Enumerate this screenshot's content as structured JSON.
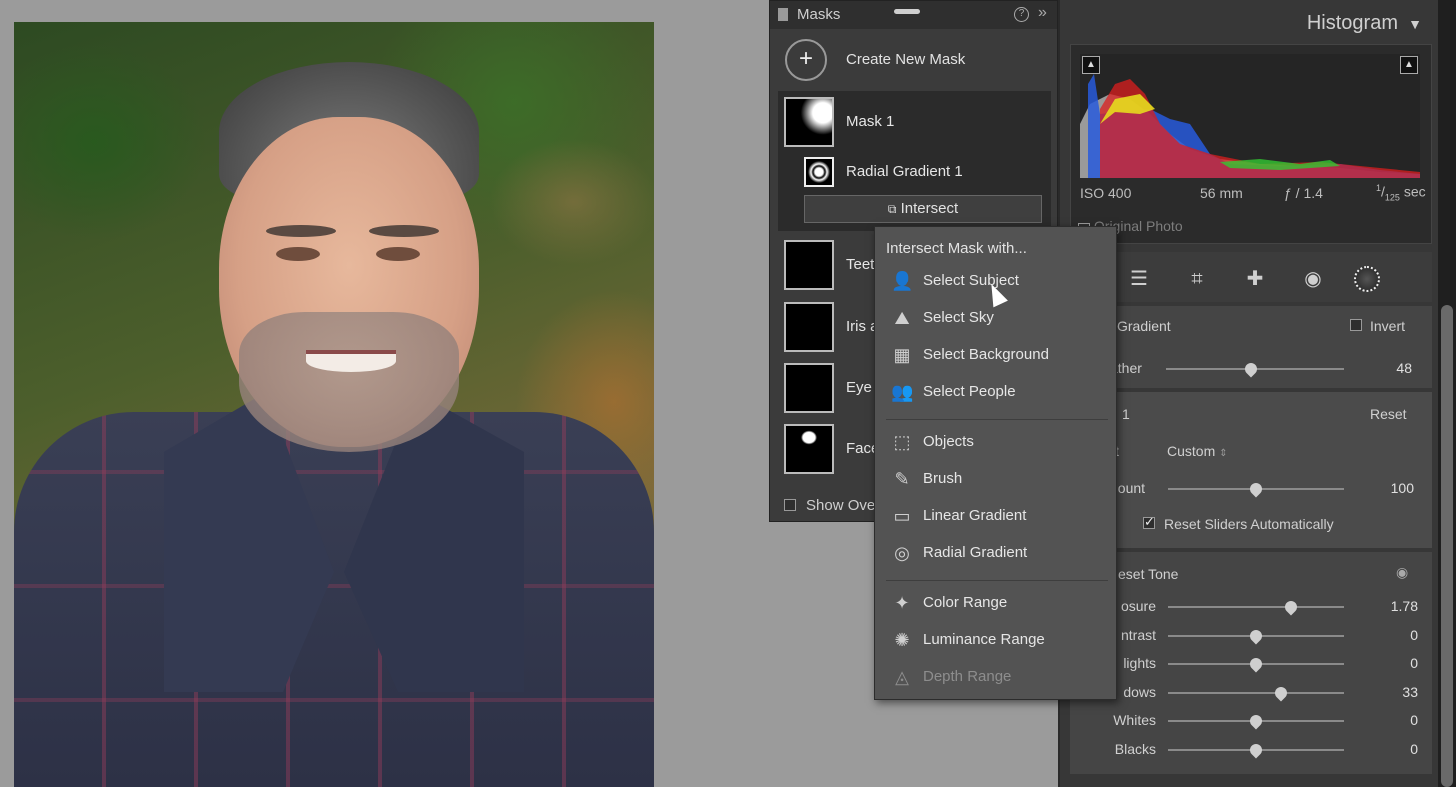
{
  "masks_panel": {
    "title": "Masks",
    "create_label": "Create New Mask",
    "mask1": {
      "name": "Mask 1",
      "component": "Radial Gradient 1",
      "intersect_label": "Intersect"
    },
    "other_masks": [
      "Teet",
      "Iris a",
      "Eye",
      "Face"
    ],
    "show_overlay_label": "Show Ove"
  },
  "menu": {
    "heading": "Intersect Mask with...",
    "groups": [
      [
        {
          "label": "Select Subject",
          "icon": "subject-icon",
          "enabled": true
        },
        {
          "label": "Select Sky",
          "icon": "sky-icon",
          "enabled": true
        },
        {
          "label": "Select Background",
          "icon": "background-icon",
          "enabled": true
        },
        {
          "label": "Select People",
          "icon": "people-icon",
          "enabled": true
        }
      ],
      [
        {
          "label": "Objects",
          "icon": "objects-icon",
          "enabled": true
        },
        {
          "label": "Brush",
          "icon": "brush-icon",
          "enabled": true
        },
        {
          "label": "Linear Gradient",
          "icon": "linear-gradient-icon",
          "enabled": true
        },
        {
          "label": "Radial Gradient",
          "icon": "radial-gradient-icon",
          "enabled": true
        }
      ],
      [
        {
          "label": "Color Range",
          "icon": "color-range-icon",
          "enabled": true
        },
        {
          "label": "Luminance Range",
          "icon": "luminance-range-icon",
          "enabled": true
        },
        {
          "label": "Depth Range",
          "icon": "depth-range-icon",
          "enabled": false
        }
      ]
    ]
  },
  "histogram": {
    "title": "Histogram",
    "iso": "ISO 400",
    "focal": "56 mm",
    "aperture": "ƒ / 1.4",
    "shutter": "1/125 sec",
    "shutter_num": "1",
    "shutter_den": "125",
    "shutter_unit": "sec",
    "original_photo_label": "Original Photo"
  },
  "mask_props": {
    "type_label": "l Gradient",
    "invert_label": "Invert",
    "feather_label": "ather",
    "feather_value": "48",
    "feather_pct": 0.48
  },
  "preset": {
    "title": "1",
    "reset_label": "Reset",
    "preset_label": "t",
    "preset_value": "Custom",
    "amount_label": "nount",
    "amount_value": "100",
    "amount_pct": 0.5,
    "reset_sliders_label": "Reset Sliders Automatically"
  },
  "tone": {
    "title": "eset Tone",
    "sliders": [
      {
        "label": "osure",
        "value": "1.78",
        "pct": 0.7
      },
      {
        "label": "ntrast",
        "value": "0",
        "pct": 0.5
      },
      {
        "label": "lights",
        "value": "0",
        "pct": 0.5
      },
      {
        "label": "dows",
        "value": "33",
        "pct": 0.64
      },
      {
        "label": "Whites",
        "value": "0",
        "pct": 0.5
      },
      {
        "label": "Blacks",
        "value": "0",
        "pct": 0.5
      }
    ]
  },
  "colors": {
    "panel": "#373737",
    "menu": "#535353",
    "accent": "#e6e6e6"
  }
}
